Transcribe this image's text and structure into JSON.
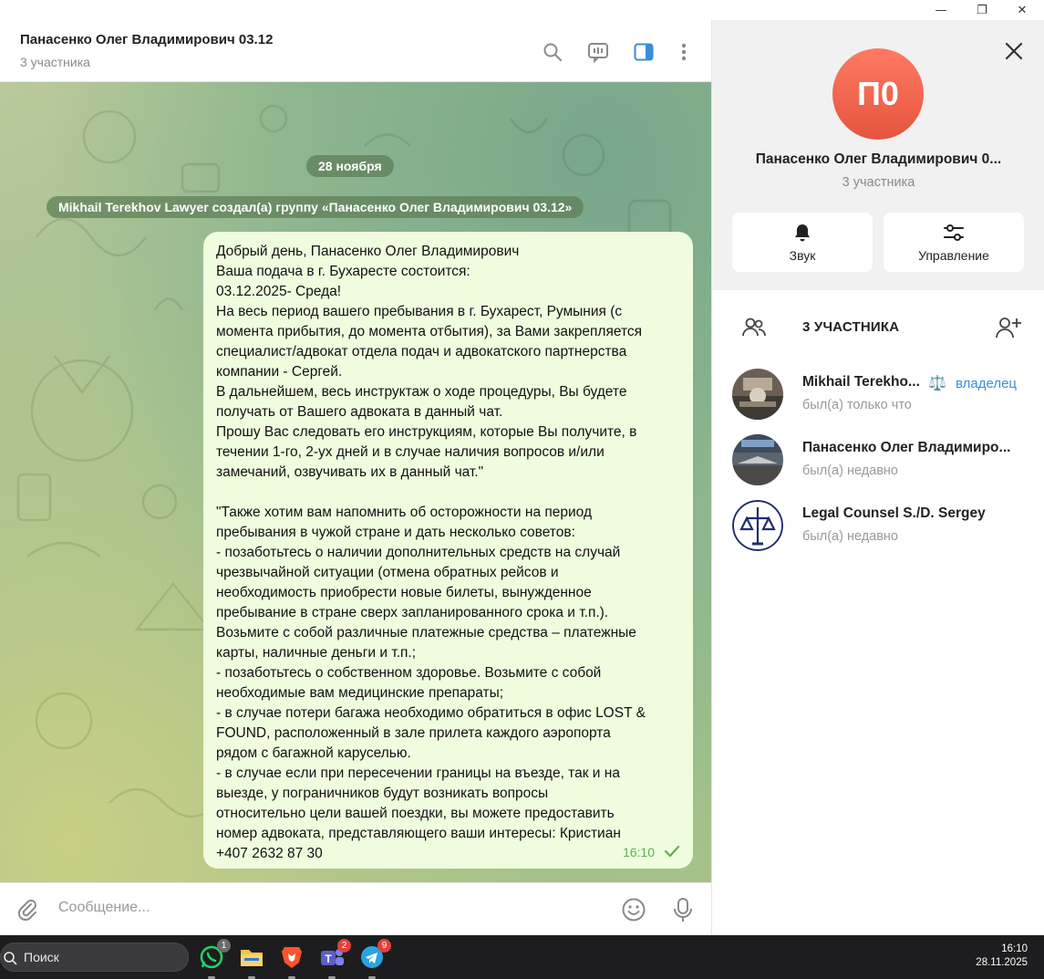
{
  "window": {
    "minimize_glyph": "—",
    "restore_glyph": "❐",
    "close_glyph": "✕"
  },
  "chat": {
    "title": "Панасенко Олег Владимирович 03.12",
    "subtitle": "3 участника",
    "header_icons": [
      "search-icon",
      "video-chat-icon",
      "sidebar-toggle-icon",
      "more-vertical-icon"
    ],
    "date_pill": "28 ноября",
    "service_message": "Mikhail Terekhov Lawyer создал(а) группу «Панасенко Олег Владимирович 03.12»",
    "message": {
      "text": "Добрый день, Панасенко Олег Владимирович\nВаша подача в г. Бухаресте состоится:\n03.12.2025- Среда!\nНа весь период вашего пребывания в г. Бухарест, Румыния (с\nмомента прибытия, до момента отбытия), за Вами закрепляется\nспециалист/адвокат отдела подач и адвокатского партнерства\nкомпании - Сергей.\nВ дальнейшем, весь инструктаж о ходе процедуры, Вы будете\nполучать от Вашего адвоката в данный чат.\nПрошу Вас следовать его инструкциям, которые Вы получите, в\nтечении 1-го, 2-ух дней и в случае наличия вопросов и/или\nзамечаний, озвучивать их в данный чат.\"\n\n\"Также хотим вам напомнить об осторожности на период\nпребывания в чужой стране и дать несколько советов:\n- позаботьтесь о наличии дополнительных средств на случай\nчрезвычайной ситуации (отмена обратных рейсов и\nнеобходимость приобрести новые билеты, вынужденное\nпребывание в стране сверх запланированного срока и т.п.).\nВозьмите с собой различные платежные средства – платежные\nкарты, наличные деньги и т.п.;\n- позаботьтесь о собственном здоровье. Возьмите с собой\nнеобходимые вам медицинские препараты;\n- в случае потери багажа необходимо обратиться в офис LOST &\nFOUND, расположенный в зале прилета каждого аэропорта\nрядом с багажной каруселью.\n- в случае если при пересечении границы на въезде, так и на\nвыезде, у пограничников будут возникать вопросы\nотносительно цели вашей поездки, вы можете предоставить\nномер адвоката, представляющего ваши интересы: Кристиан\n+407 2632 87 30",
      "time": "16:10",
      "status": "read"
    },
    "composer_placeholder": "Сообщение..."
  },
  "info_panel": {
    "avatar_initials": "П0",
    "name": "Панасенко Олег Владимирович 0...",
    "subtitle": "3 участника",
    "actions": [
      {
        "label": "Звук",
        "icon": "bell-icon"
      },
      {
        "label": "Управление",
        "icon": "sliders-icon"
      }
    ],
    "members_title": "3 УЧАСТНИКА",
    "members": [
      {
        "name": "Mikhail Terekho...",
        "emoji": "⚖️",
        "role": "владелец",
        "status": "был(а) только что"
      },
      {
        "name": "Панасенко Олег Владимиро...",
        "role": "",
        "status": "был(а) недавно"
      },
      {
        "name": "Legal Counsel S./D. Sergey",
        "role": "",
        "status": "был(а) недавно"
      }
    ]
  },
  "taskbar": {
    "search_label": "Поиск",
    "apps": [
      {
        "name": "whatsapp",
        "badge": "1",
        "color": "#25d366"
      },
      {
        "name": "file-explorer",
        "badge": "",
        "color": "#f5c242"
      },
      {
        "name": "brave",
        "badge": "",
        "color": "#fb542b"
      },
      {
        "name": "teams",
        "badge": "2",
        "color": "#5b5fc7"
      },
      {
        "name": "telegram",
        "badge": "9",
        "color": "#2aa3e0"
      }
    ],
    "time": "16:10",
    "date": "28.11.2025"
  }
}
